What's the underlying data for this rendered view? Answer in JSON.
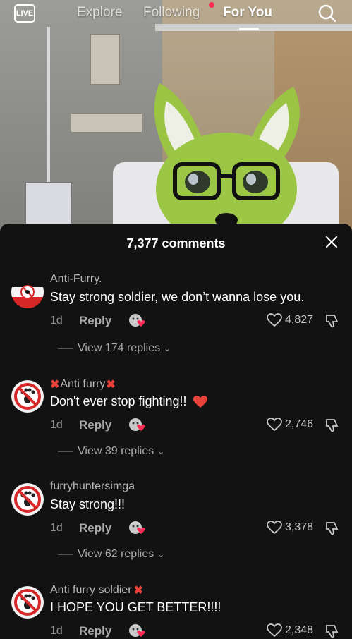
{
  "topbar": {
    "live_label": "LIVE",
    "tabs": [
      {
        "label": "Explore"
      },
      {
        "label": "Following"
      },
      {
        "label": "For You"
      }
    ],
    "active_tab": "For You",
    "notification_color": "#fe2c55"
  },
  "sheet": {
    "title": "7,377 comments",
    "close_icon": "close-icon"
  },
  "comments": [
    {
      "username": "Anti-Furry.",
      "text": "Stay strong soldier, we don’t wanna lose you.",
      "time": "1d",
      "reply_label": "Reply",
      "likes": "4,827",
      "view_replies": "View 174 replies",
      "avatar": "flag-avatar"
    },
    {
      "username": "Anti furry",
      "text": "Don't ever stop fighting!!",
      "time": "1d",
      "reply_label": "Reply",
      "likes": "2,746",
      "view_replies": "View 39 replies",
      "avatar": "no-paw-avatar"
    },
    {
      "username": "furryhuntersimga",
      "text": "Stay strong!!!",
      "time": "1d",
      "reply_label": "Reply",
      "likes": "3,378",
      "view_replies": "View 62 replies",
      "avatar": "no-paw-avatar"
    },
    {
      "username": "Anti furry soldier",
      "text": "I HOPE YOU GET BETTER!!!!",
      "time": "1d",
      "reply_label": "Reply",
      "likes": "2,348",
      "avatar": "no-paw-avatar"
    }
  ],
  "colors": {
    "accent": "#fe2c55",
    "sheet_bg": "#121212",
    "mark_red": "#e8433b"
  }
}
